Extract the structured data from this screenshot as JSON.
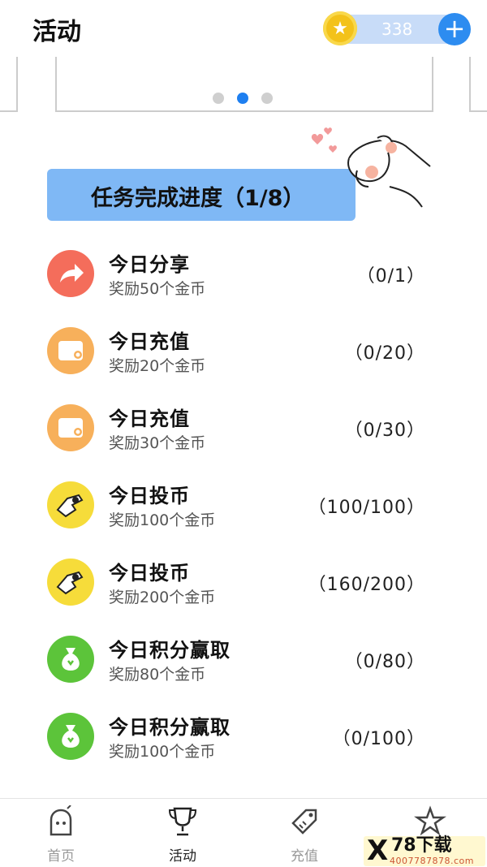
{
  "header": {
    "title": "活动",
    "coins": "338",
    "plus_icon": "plus-icon",
    "coin_icon": "star-coin-icon"
  },
  "carousel": {
    "dots": 3,
    "active_index": 1
  },
  "progress": {
    "text": "任务完成进度（1/8）"
  },
  "tasks": [
    {
      "title": "今日分享",
      "reward": "奖励50个金币",
      "progress": "（0/1）",
      "icon": "share-arrow-icon",
      "color": "#f46d5b"
    },
    {
      "title": "今日充值",
      "reward": "奖励20个金币",
      "progress": "（0/20）",
      "icon": "wallet-icon",
      "color": "#f7b05b"
    },
    {
      "title": "今日充值",
      "reward": "奖励30个金币",
      "progress": "（0/30）",
      "icon": "wallet-icon",
      "color": "#f7b05b"
    },
    {
      "title": "今日投币",
      "reward": "奖励100个金币",
      "progress": "（100/100）",
      "icon": "hand-coin-icon",
      "color": "#f6dc3a"
    },
    {
      "title": "今日投币",
      "reward": "奖励200个金币",
      "progress": "（160/200）",
      "icon": "hand-coin-icon",
      "color": "#f6dc3a"
    },
    {
      "title": "今日积分赢取",
      "reward": "奖励80个金币",
      "progress": "（0/80）",
      "icon": "money-bag-icon",
      "color": "#5cc43a"
    },
    {
      "title": "今日积分赢取",
      "reward": "奖励100个金币",
      "progress": "（0/100）",
      "icon": "money-bag-icon",
      "color": "#5cc43a"
    }
  ],
  "nav": [
    {
      "label": "首页",
      "icon": "ghost-icon",
      "active": false
    },
    {
      "label": "活动",
      "icon": "trophy-icon",
      "active": true
    },
    {
      "label": "充值",
      "icon": "tag-icon",
      "active": false
    },
    {
      "label": "",
      "icon": "star-icon",
      "active": false
    }
  ],
  "watermark": {
    "mark": "X",
    "title": "78下载",
    "url": "4007787878.com"
  },
  "colors": {
    "accent": "#2d8cf0",
    "progress_bg": "#7fb8f5",
    "coin": "#f3c21a"
  }
}
